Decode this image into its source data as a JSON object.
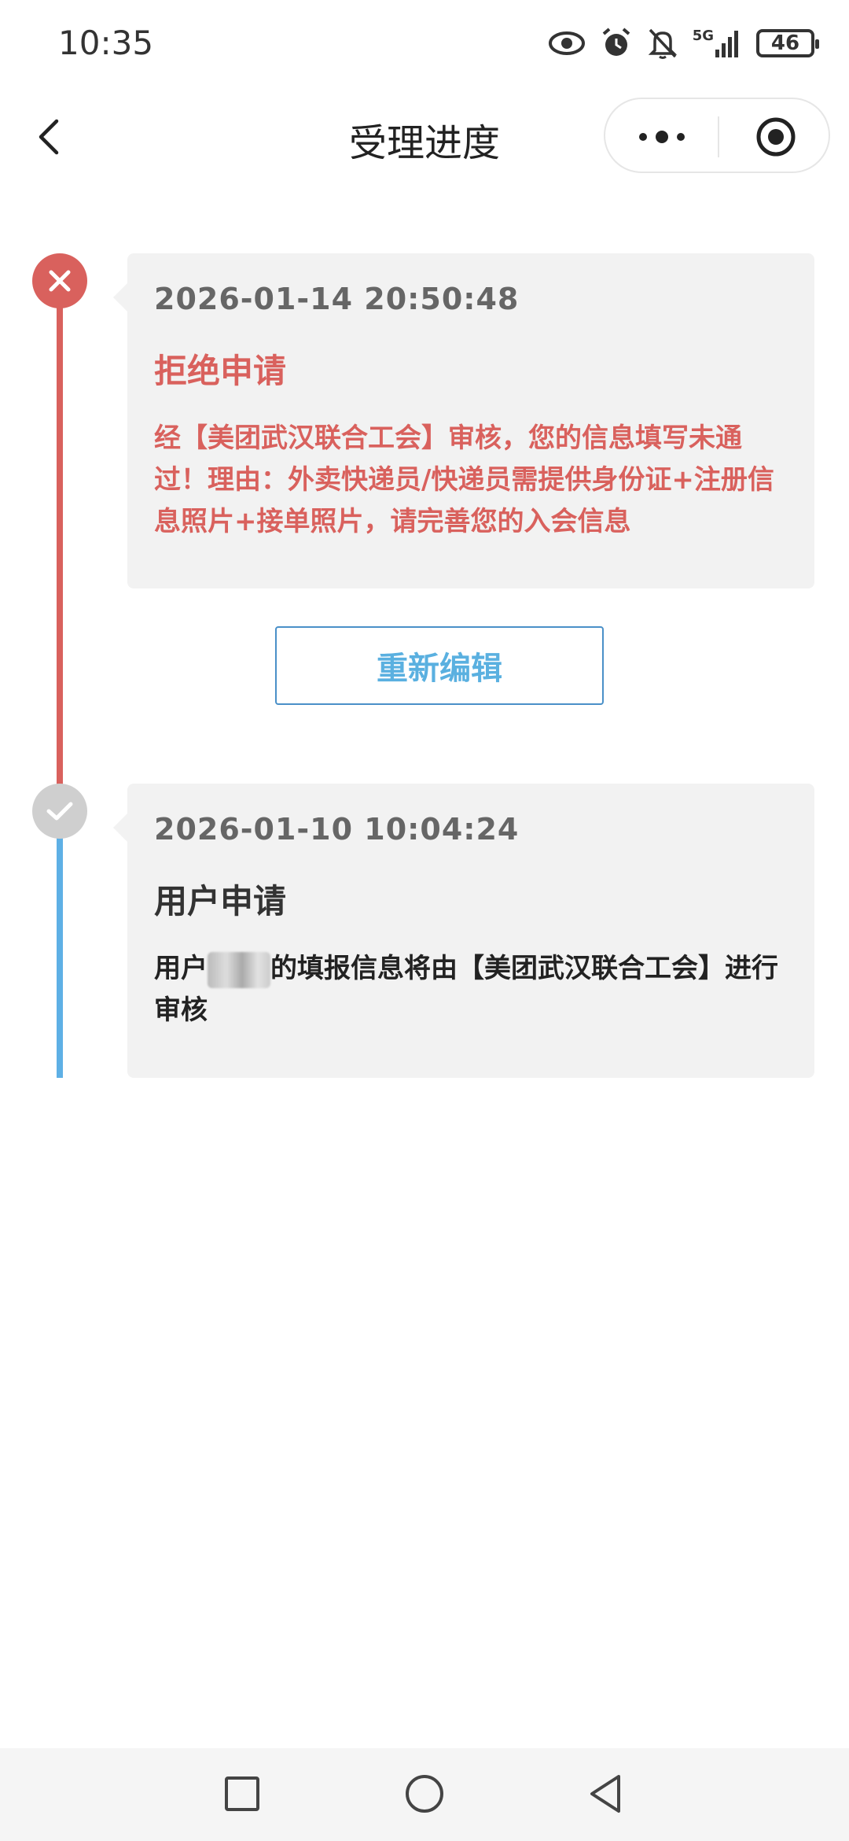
{
  "status_bar": {
    "time": "10:35",
    "network": "5G",
    "battery": "46",
    "icons": [
      "eye-icon",
      "alarm-icon",
      "bell-off-icon",
      "signal-icon",
      "battery-icon"
    ]
  },
  "nav": {
    "title": "受理进度",
    "back_icon": "chevron-left-icon",
    "more_icon": "more-dots-icon",
    "close_icon": "target-circle-icon"
  },
  "timeline": [
    {
      "time": "2026-01-14 20:50:48",
      "status": "拒绝申请",
      "description": "经【美团武汉联合工会】审核，您的信息填写未通过！理由：外卖快递员/快递员需提供身份证+注册信息照片+接单照片，请完善您的入会信息",
      "icon": "close-x-icon",
      "color": "#d9615d"
    },
    {
      "time": "2026-01-10 10:04:24",
      "status": "用户申请",
      "description_prefix": "用户",
      "description_suffix": "的填报信息将由【美团武汉联合工会】进行审核",
      "icon": "check-icon",
      "color": "#5eb0e5"
    }
  ],
  "actions": {
    "re_edit_label": "重新编辑"
  },
  "bottom_nav": {
    "icons": [
      "square-recents-icon",
      "circle-home-icon",
      "triangle-back-icon"
    ]
  }
}
